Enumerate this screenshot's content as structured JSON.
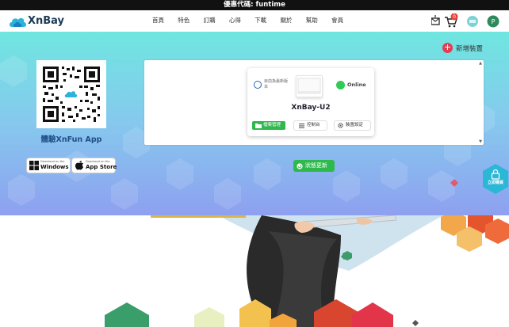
{
  "promo_bar": {
    "text": "優惠代碼: funtime"
  },
  "header": {
    "brand": "XnBay",
    "nav_items": [
      "首頁",
      "特色",
      "訂購",
      "心得",
      "下載",
      "關於",
      "幫助",
      "會員"
    ],
    "cart_count": "0",
    "user_initial": "P"
  },
  "hero": {
    "app_title": "體驗XnFun App",
    "windows_store": {
      "small": "Download on the",
      "big": "Windows"
    },
    "app_store": {
      "small": "Download on the",
      "big": "App Store"
    },
    "add_device_label": "新增裝置",
    "update_button": "狀態更新",
    "buy_now": "立即購買"
  },
  "device_card": {
    "firmware_text": "目前為最新版本",
    "status": "Online",
    "name": "XnBay-U2",
    "btn_files": "檔案管理",
    "btn_console": "控制台",
    "btn_settings": "裝置設定"
  },
  "colors": {
    "accent_green": "#2fb94d",
    "brand_blue": "#1e4e86",
    "add_red": "#e23c55"
  }
}
